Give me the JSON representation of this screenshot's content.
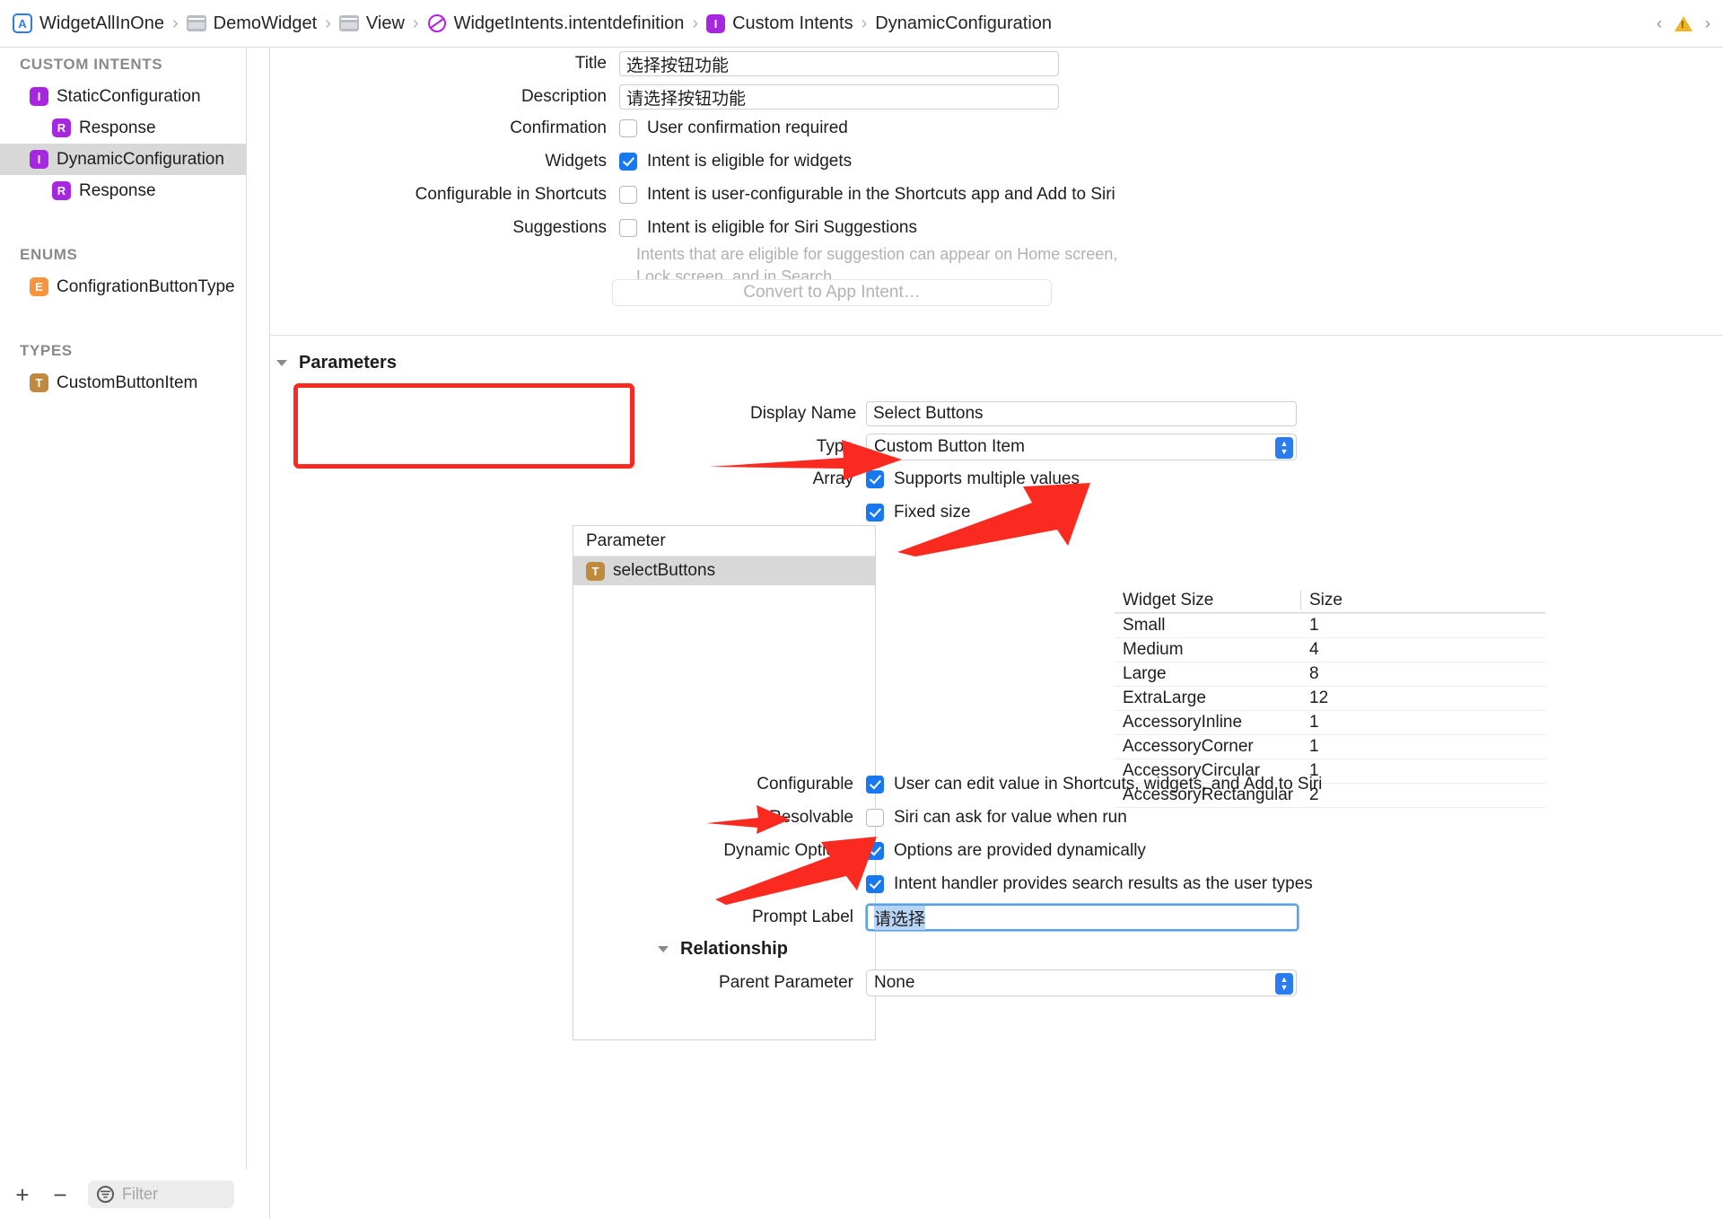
{
  "titlebar": {
    "breadcrumb": [
      {
        "label": "WidgetAllInOne",
        "icon": "app-icon",
        "glyph": "A"
      },
      {
        "label": "DemoWidget",
        "icon": "folder-icon",
        "glyph": ""
      },
      {
        "label": "View",
        "icon": "folder-icon",
        "glyph": ""
      },
      {
        "label": "WidgetIntents.intentdefinition",
        "icon": "intentdefinition-icon",
        "glyph": ""
      },
      {
        "label": "Custom Intents",
        "icon": "intent-badge-icon",
        "glyph": "I"
      },
      {
        "label": "DynamicConfiguration",
        "icon": "none",
        "glyph": ""
      }
    ],
    "separator": "›",
    "nav_back": "‹",
    "nav_forward": "›",
    "warning_glyph": "!"
  },
  "sidebar": {
    "sections": [
      {
        "title": "CUSTOM INTENTS",
        "items": [
          {
            "label": "StaticConfiguration",
            "badge": "I",
            "badge_color": "#a726e0",
            "indent": 1,
            "selected": false
          },
          {
            "label": "Response",
            "badge": "R",
            "badge_color": "#a726e0",
            "indent": 2,
            "selected": false
          },
          {
            "label": "DynamicConfiguration",
            "badge": "I",
            "badge_color": "#a726e0",
            "indent": 1,
            "selected": true
          },
          {
            "label": "Response",
            "badge": "R",
            "badge_color": "#a726e0",
            "indent": 2,
            "selected": false
          }
        ]
      },
      {
        "title": "ENUMS",
        "items": [
          {
            "label": "ConfigrationButtonType",
            "badge": "E",
            "badge_color": "#f7943e",
            "indent": 1,
            "selected": false
          }
        ]
      },
      {
        "title": "TYPES",
        "items": [
          {
            "label": "CustomButtonItem",
            "badge": "T",
            "badge_color": "#c08a3e",
            "indent": 1,
            "selected": false
          }
        ]
      }
    ],
    "toolbar": {
      "add_label": "+",
      "remove_label": "−",
      "filter_placeholder": "Filter",
      "filter_value": ""
    }
  },
  "intent": {
    "title_label": "Title",
    "title_value": "选择按钮功能",
    "description_label": "Description",
    "description_value": "请选择按钮功能",
    "confirmation_label": "Confirmation",
    "confirmation_text": "User confirmation required",
    "confirmation_checked": false,
    "widgets_label": "Widgets",
    "widgets_text": "Intent is eligible for widgets",
    "widgets_checked": true,
    "shortcuts_label": "Configurable in Shortcuts",
    "shortcuts_text": "Intent is user-configurable in the Shortcuts app and Add to Siri",
    "shortcuts_checked": false,
    "suggestions_label": "Suggestions",
    "suggestions_text": "Intent is eligible for Siri Suggestions",
    "suggestions_checked": false,
    "suggestions_hint_line1": "Intents that are eligible for suggestion can appear on Home screen,",
    "suggestions_hint_line2": "Lock screen, and in Search.",
    "convert_button": "Convert to App Intent…"
  },
  "parameters": {
    "section_title": "Parameters",
    "column_header": "Parameter",
    "rows": [
      {
        "name": "selectButtons",
        "badge": "T",
        "badge_color": "#c08a3e",
        "selected": true
      }
    ]
  },
  "detail": {
    "display_name_label": "Display Name",
    "display_name_value": "Select Buttons",
    "type_label": "Type",
    "type_value": "Custom Button Item",
    "array_label": "Array",
    "array_text": "Supports multiple values",
    "array_checked": true,
    "fixed_size_text": "Fixed size",
    "fixed_size_checked": true,
    "size_table": {
      "headers": [
        "Widget Size",
        "Size"
      ],
      "rows": [
        {
          "widget_size": "Small",
          "size": "1"
        },
        {
          "widget_size": "Medium",
          "size": "4"
        },
        {
          "widget_size": "Large",
          "size": "8"
        },
        {
          "widget_size": "ExtraLarge",
          "size": "12"
        },
        {
          "widget_size": "AccessoryInline",
          "size": "1"
        },
        {
          "widget_size": "AccessoryCorner",
          "size": "1"
        },
        {
          "widget_size": "AccessoryCircular",
          "size": "1"
        },
        {
          "widget_size": "AccessoryRectangular",
          "size": "2"
        }
      ]
    },
    "configurable_label": "Configurable",
    "configurable_text": "User can edit value in Shortcuts, widgets, and Add to Siri",
    "configurable_checked": true,
    "resolvable_label": "Resolvable",
    "resolvable_text": "Siri can ask for value when run",
    "resolvable_checked": false,
    "dynamic_options_label": "Dynamic Options",
    "dynamic_options_text": "Options are provided dynamically",
    "dynamic_options_checked": true,
    "search_results_text": "Intent handler provides search results as the user types",
    "search_results_checked": true,
    "prompt_label_label": "Prompt Label",
    "prompt_label_value": "请选择",
    "relationship_title": "Relationship",
    "parent_parameter_label": "Parent Parameter",
    "parent_parameter_value": "None"
  },
  "colors": {
    "accent_blue": "#1878f0",
    "annotation_red": "#fb2a21",
    "selection_gray": "#d8d8d8",
    "tab_accent": "#cde4f7"
  }
}
